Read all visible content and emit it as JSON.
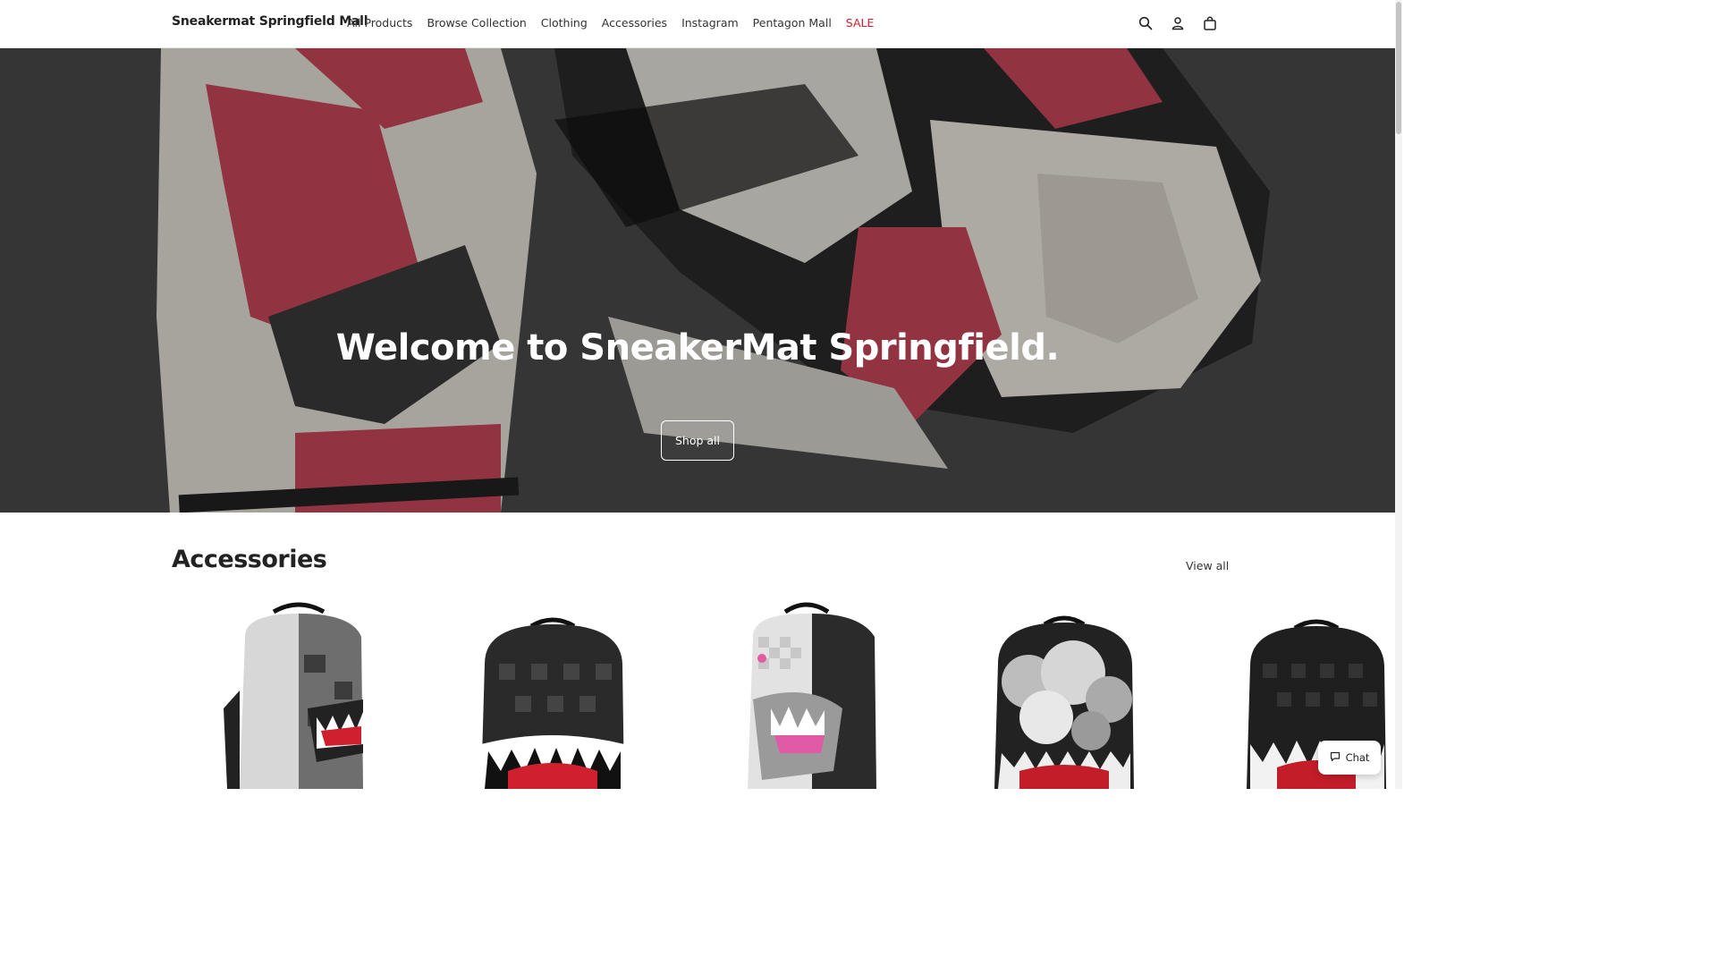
{
  "header": {
    "brand": "Sneakermat Springfield Mall",
    "nav": [
      {
        "label": "All Products"
      },
      {
        "label": "Browse Collection"
      },
      {
        "label": "Clothing"
      },
      {
        "label": "Accessories"
      },
      {
        "label": "Instagram"
      },
      {
        "label": "Pentagon Mall"
      },
      {
        "label": "SALE"
      }
    ],
    "icons": [
      "search-icon",
      "account-icon",
      "cart-icon"
    ]
  },
  "hero": {
    "title": "Welcome to SneakerMat Springfield.",
    "button_label": "Shop all"
  },
  "accessories": {
    "title": "Accessories",
    "view_all_label": "View all",
    "products": [
      {
        "style": "silver-shark-split"
      },
      {
        "style": "black-checker-shark"
      },
      {
        "style": "gray-checker-pink-shark"
      },
      {
        "style": "cloud-red-mouth"
      },
      {
        "style": "black-checker-shark-partial"
      }
    ]
  },
  "chat": {
    "label": "Chat"
  },
  "colors": {
    "sale": "#d0202d",
    "text": "#222222",
    "hero_overlay": "#000000"
  }
}
